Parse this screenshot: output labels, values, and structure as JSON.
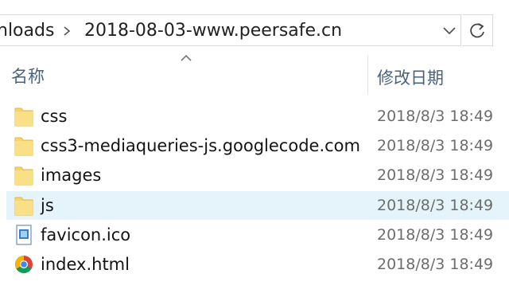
{
  "address": {
    "previous_crumb": "nloads",
    "current_folder": "2018-08-03-www.peersafe.cn"
  },
  "columns": {
    "name": "名称",
    "modified": "修改日期"
  },
  "files": [
    {
      "name": "css",
      "date": "2018/8/3 18:49",
      "icon": "folder-icon"
    },
    {
      "name": "css3-mediaqueries-js.googlecode.com",
      "date": "2018/8/3 18:49",
      "icon": "folder-icon"
    },
    {
      "name": "images",
      "date": "2018/8/3 18:49",
      "icon": "folder-icon"
    },
    {
      "name": "js",
      "date": "2018/8/3 18:49",
      "icon": "folder-icon",
      "selected": true
    },
    {
      "name": "favicon.ico",
      "date": "2018/8/3 18:49",
      "icon": "image-file-icon"
    },
    {
      "name": "index.html",
      "date": "2018/8/3 18:49",
      "icon": "chrome-icon"
    }
  ],
  "colors": {
    "folder": "#f6d36b",
    "selection": "#e5f3fb",
    "header_text": "#4c607a"
  }
}
